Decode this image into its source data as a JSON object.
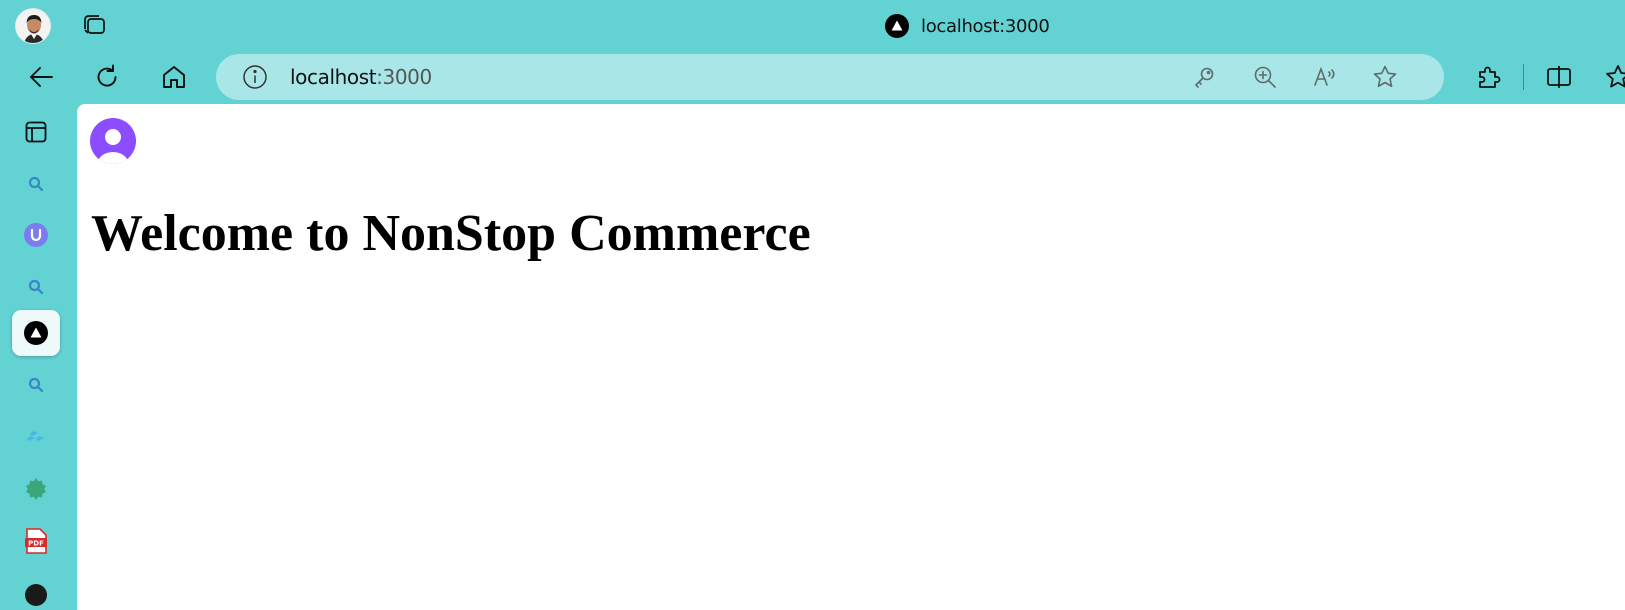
{
  "window": {
    "tab_title": "localhost:3000"
  },
  "toolbar": {
    "url_host": "localhost",
    "url_port": ":3000"
  },
  "page": {
    "heading": "Welcome to NonStop Commerce"
  },
  "icons": {
    "titlebar": [
      "profile-avatar",
      "tabs-icon",
      "nextjs-favicon"
    ],
    "toolbar": [
      "back-icon",
      "refresh-icon",
      "home-icon",
      "info-icon",
      "key-icon",
      "zoom-icon",
      "read-aloud-icon",
      "favorite-star-icon",
      "extensions-icon",
      "split-screen-icon",
      "favorites-icon"
    ],
    "sidebar": [
      "tab-overview-icon",
      "search-icon",
      "u-extension-icon",
      "search-icon",
      "nextjs-icon",
      "search-icon",
      "tailwind-icon",
      "gear-badge-icon",
      "pdf-icon",
      "github-icon"
    ]
  },
  "colors": {
    "frame": "#62d2d3",
    "addressbar": "#a9e6e7",
    "page_background": "#ffffff",
    "avatar_purple": "#8b4dff"
  }
}
